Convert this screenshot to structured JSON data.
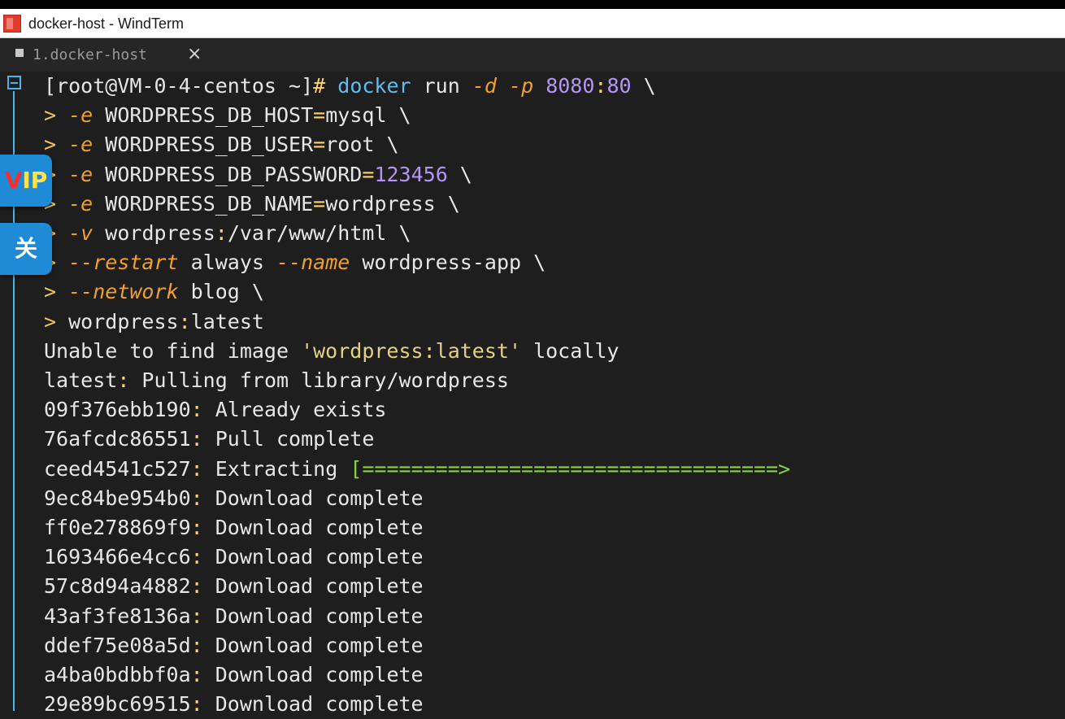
{
  "window": {
    "title": "docker-host - WindTerm",
    "app_icon": "windterm-logo"
  },
  "tab": {
    "label": "1.docker-host",
    "close_glyph": "×"
  },
  "terminal": {
    "prompt": "[root@VM-0-4-centos ~]#",
    "lines": [
      "[root@VM-0-4-centos ~]# docker run -d -p 8080:80 \\",
      "> -e WORDPRESS_DB_HOST=mysql \\",
      "> -e WORDPRESS_DB_USER=root \\",
      "> -e WORDPRESS_DB_PASSWORD=123456 \\",
      "> -e WORDPRESS_DB_NAME=wordpress \\",
      "> -v wordpress:/var/www/html \\",
      "> --restart always --name wordpress-app \\",
      "> --network blog \\",
      "> wordpress:latest",
      "Unable to find image 'wordpress:latest' locally",
      "latest: Pulling from library/wordpress",
      "09f376ebb190: Already exists",
      "76afcdc86551: Pull complete",
      "ceed4541c527: Extracting [==================================>                   ]",
      "9ec84be954b0: Download complete",
      "ff0e278869f9: Download complete",
      "1693466e4cc6: Download complete",
      "57c8d94a4882: Download complete",
      "43af3fe8136a: Download complete",
      "ddef75e08a5d: Download complete",
      "a4ba0bdbbf0a: Download complete",
      "29e89bc69515: Download complete"
    ],
    "colors": {
      "background": "#1e1e1e",
      "command": "#5ebcf0",
      "flag": "#f0a030",
      "number": "#b494f5",
      "string": "#e3d088",
      "progress": "#8bd048",
      "gutter": "#48b6e8"
    }
  },
  "overlay_buttons": {
    "vip_v": "V",
    "vip_ip": "IP",
    "close_label": "关"
  }
}
